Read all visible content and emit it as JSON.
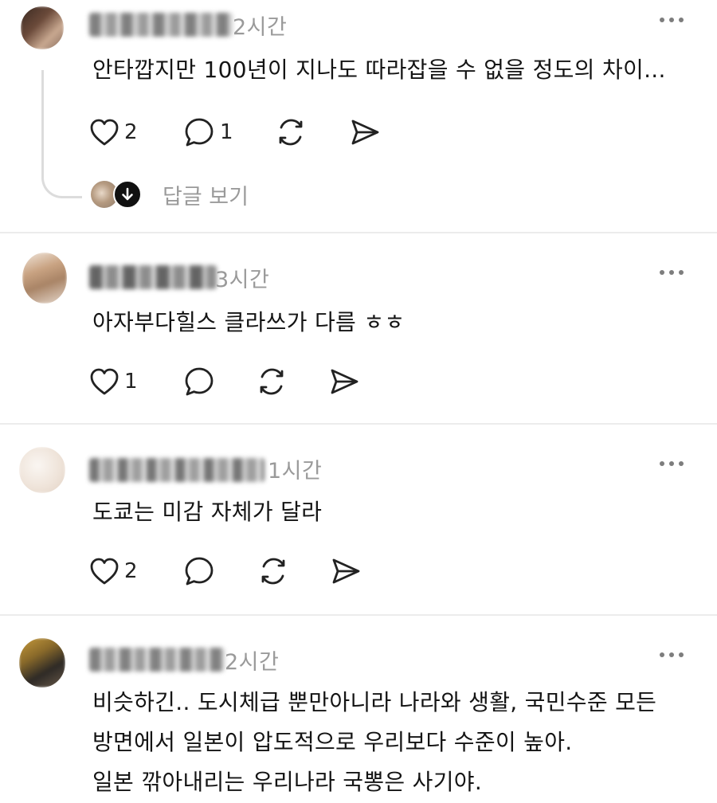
{
  "colors": {
    "text": "#141414",
    "muted": "#9a9a9a",
    "divider": "#ececec",
    "icon": "#222222"
  },
  "comments": [
    {
      "time": "2시간",
      "text_lines": [
        "안타깝지만 100년이 지나도 따라잡을 수 없을 정도의 차이..."
      ],
      "likes": "2",
      "replies": "1",
      "view_replies_label": "답글 보기"
    },
    {
      "time": "3시간",
      "text_lines": [
        "아자부다힐스 클라쓰가 다름 ㅎㅎ"
      ],
      "likes": "1",
      "replies": ""
    },
    {
      "time": "1시간",
      "text_lines": [
        "도쿄는 미감 자체가 달라"
      ],
      "likes": "2",
      "replies": ""
    },
    {
      "time": "2시간",
      "text_lines": [
        "비슷하긴.. 도시체급 뿐만아니라 나라와 생활, 국민수준 모든",
        "방면에서 일본이 압도적으로 우리보다 수준이 높아.",
        "일본 깎아내리는 우리나라 국뽕은 사기야."
      ]
    }
  ],
  "icons": {
    "like": "heart-icon",
    "reply": "speech-bubble-icon",
    "repost": "repost-icon",
    "share": "send-icon",
    "more": "more-dots-icon",
    "replies_arrow": "arrow-down-icon"
  }
}
